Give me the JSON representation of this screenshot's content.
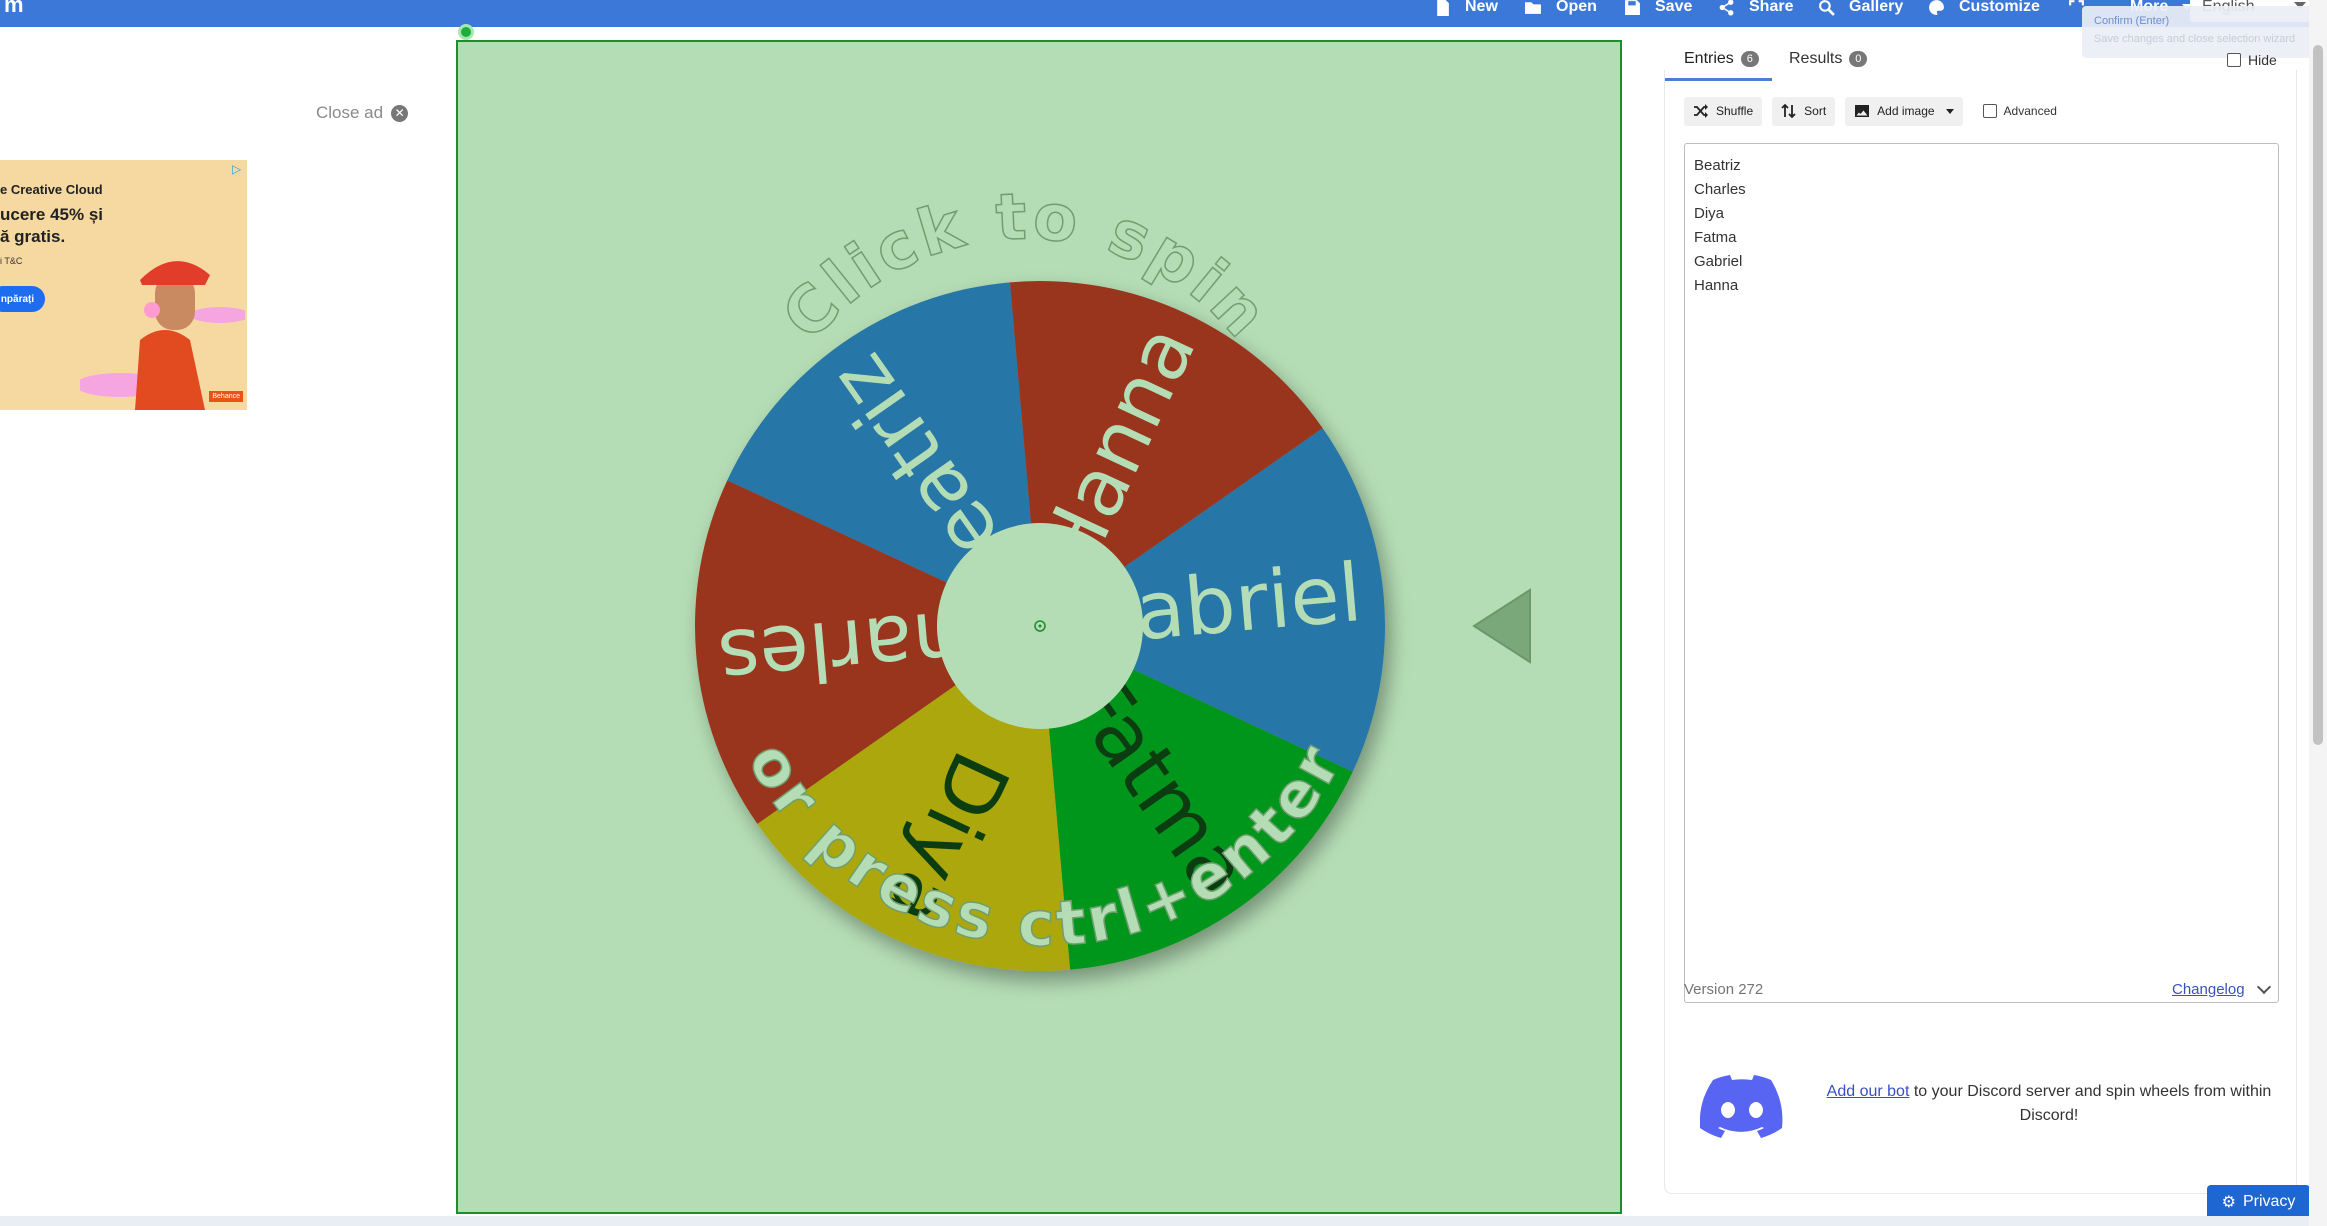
{
  "toolbar": {
    "brand": "m",
    "new": "New",
    "open": "Open",
    "save": "Save",
    "share": "Share",
    "gallery": "Gallery",
    "customize": "Customize",
    "more": "More",
    "language": "English"
  },
  "tooltip": {
    "line1": "Confirm (Enter)",
    "line2": "Save changes and close selection wizard"
  },
  "ad": {
    "close": "Close ad",
    "line1": "e Creative Cloud",
    "line2": "ucere 45% și",
    "line3": "ă gratis.",
    "line4": "i T&C",
    "button": "npărați",
    "badge": "Behance"
  },
  "wheel": {
    "center_text_top": "Click to spin",
    "center_text_bottom": "or press ctrl+enter",
    "segments": [
      {
        "label": "Gabriel",
        "color": "#2776a8"
      },
      {
        "label": "Fatma",
        "color": "#05961b"
      },
      {
        "label": "Diya",
        "color": "#aba70d"
      },
      {
        "label": "Charles",
        "color": "#98351e"
      },
      {
        "label": "Beatriz",
        "color": "#2776a8"
      },
      {
        "label": "Hanna",
        "color": "#98351e"
      }
    ]
  },
  "panel": {
    "tab_entries": "Entries",
    "entries_count": "6",
    "tab_results": "Results",
    "results_count": "0",
    "hide": "Hide",
    "shuffle": "Shuffle",
    "sort": "Sort",
    "add_image": "Add image",
    "advanced": "Advanced",
    "entries": [
      "Beatriz",
      "Charles",
      "Diya",
      "Fatma",
      "Gabriel",
      "Hanna"
    ],
    "version": "Version 272",
    "changelog": "Changelog",
    "discord_link": "Add our bot",
    "discord_text": " to your Discord server and spin wheels from within Discord!"
  },
  "privacy": "Privacy"
}
